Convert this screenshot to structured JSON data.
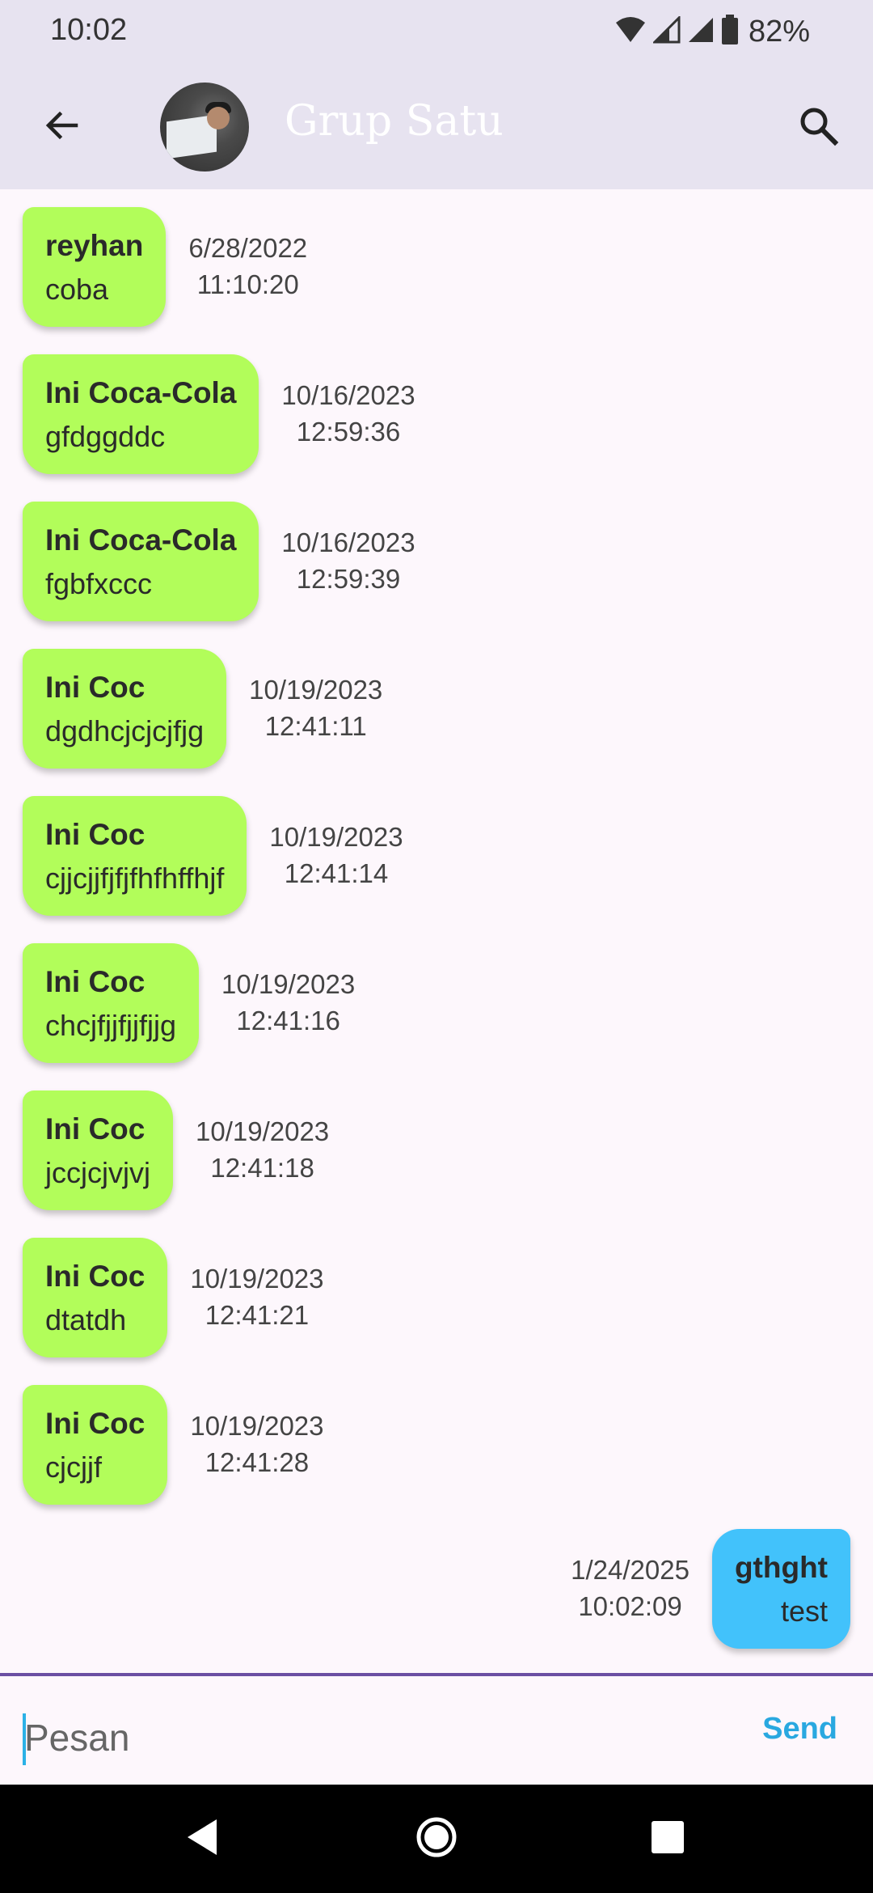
{
  "status_bar": {
    "time": "10:02",
    "battery_percent": "82%",
    "icons": [
      "wifi-icon",
      "signal-icon",
      "signal-icon",
      "battery-icon"
    ]
  },
  "app_bar": {
    "title": "Grup Satu",
    "back_icon": "arrow-left-icon",
    "search_icon": "search-icon"
  },
  "messages": [
    {
      "direction": "incoming",
      "sender": "reyhan",
      "text": "coba",
      "date": "6/28/2022",
      "time": "11:10:20"
    },
    {
      "direction": "incoming",
      "sender": "Ini Coca-Cola",
      "text": "gfdggddc",
      "date": "10/16/2023",
      "time": "12:59:36"
    },
    {
      "direction": "incoming",
      "sender": "Ini Coca-Cola",
      "text": "fgbfxccc",
      "date": "10/16/2023",
      "time": "12:59:39"
    },
    {
      "direction": "incoming",
      "sender": "Ini Coc",
      "text": "dgdhcjcjcjfjg",
      "date": "10/19/2023",
      "time": "12:41:11"
    },
    {
      "direction": "incoming",
      "sender": "Ini Coc",
      "text": "cjjcjjfjfjfhfhffhjf",
      "date": "10/19/2023",
      "time": "12:41:14"
    },
    {
      "direction": "incoming",
      "sender": "Ini Coc",
      "text": "chcjfjjfjjfjjg",
      "date": "10/19/2023",
      "time": "12:41:16"
    },
    {
      "direction": "incoming",
      "sender": "Ini Coc",
      "text": "jccjcjvjvj",
      "date": "10/19/2023",
      "time": "12:41:18"
    },
    {
      "direction": "incoming",
      "sender": "Ini Coc",
      "text": "dtatdh",
      "date": "10/19/2023",
      "time": "12:41:21"
    },
    {
      "direction": "incoming",
      "sender": "Ini Coc",
      "text": "cjcjjf",
      "date": "10/19/2023",
      "time": "12:41:28"
    },
    {
      "direction": "outgoing",
      "sender": "gthght",
      "text": "test",
      "date": "1/24/2025",
      "time": "10:02:09"
    }
  ],
  "input": {
    "placeholder": "Pesan",
    "value": "",
    "send_label": "Send"
  },
  "colors": {
    "incoming_bubble": "#b2fd5a",
    "outgoing_bubble": "#42c2fb",
    "app_bar": "#e7e3f0",
    "accent": "#29a8e0",
    "divider": "#6b4fa3"
  }
}
